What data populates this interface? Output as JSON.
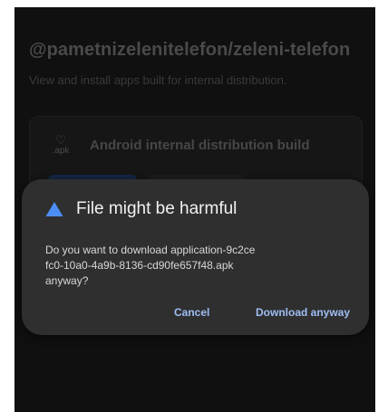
{
  "page": {
    "title": "@pametnizelenitelefon/zeleni-telefon",
    "subtitle": "View and install apps built for internal distribution."
  },
  "build_card": {
    "apk_icon_label": ".apk",
    "title": "Android internal distribution build"
  },
  "dialog": {
    "icon": "warning-triangle-icon",
    "icon_color": "#4c8df6",
    "title": "File might be harmful",
    "message_lines": [
      "Do you want to download application-9c2ce",
      "fc0-10a0-4a9b-8136-cd90fe657f48.apk",
      "anyway?"
    ],
    "cancel_label": "Cancel",
    "download_label": "Download anyway"
  },
  "colors": {
    "screen_background": "#101010",
    "dialog_background": "#2f2f30",
    "action_text": "#9ebdf2"
  }
}
